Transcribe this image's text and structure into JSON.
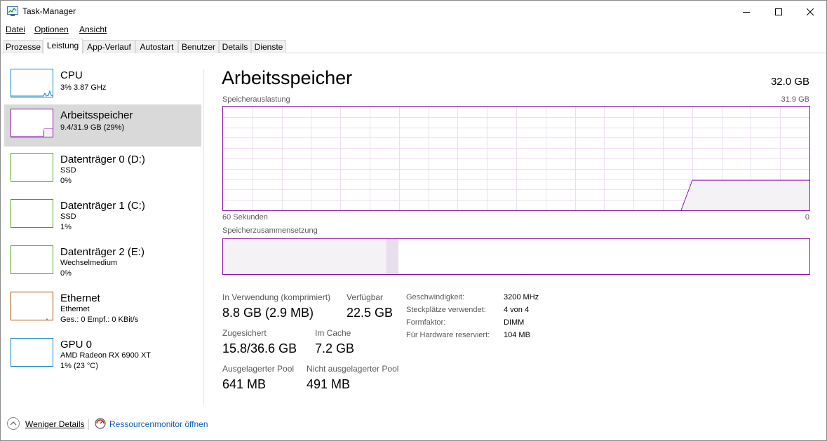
{
  "window": {
    "title": "Task-Manager"
  },
  "menu": [
    {
      "label": "Datei"
    },
    {
      "label": "Optionen"
    },
    {
      "label": "Ansicht"
    }
  ],
  "tabs": [
    {
      "label": "Prozesse"
    },
    {
      "label": "Leistung",
      "active": true
    },
    {
      "label": "App-Verlauf"
    },
    {
      "label": "Autostart"
    },
    {
      "label": "Benutzer"
    },
    {
      "label": "Details"
    },
    {
      "label": "Dienste"
    }
  ],
  "sidebar": {
    "items": [
      {
        "title": "CPU",
        "line1": "3%  3.87 GHz",
        "line2": "",
        "color": "#1182c9"
      },
      {
        "title": "Arbeitsspeicher",
        "line1": "9.4/31.9 GB (29%)",
        "line2": "",
        "color": "#8b12ae",
        "selected": true
      },
      {
        "title": "Datenträger 0 (D:)",
        "line1": "SSD",
        "line2": "0%",
        "color": "#4da60c"
      },
      {
        "title": "Datenträger 1 (C:)",
        "line1": "SSD",
        "line2": "1%",
        "color": "#4da60c"
      },
      {
        "title": "Datenträger 2 (E:)",
        "line1": "Wechselmedium",
        "line2": "0%",
        "color": "#4da60c"
      },
      {
        "title": "Ethernet",
        "line1": "Ethernet",
        "line2": "Ges.: 0 Empf.: 0 KBit/s",
        "color": "#a74f01"
      },
      {
        "title": "GPU 0",
        "line1": "AMD Radeon RX 6900 XT",
        "line2": "1% (23 °C)",
        "color": "#1182c9"
      }
    ]
  },
  "main": {
    "title": "Arbeitsspeicher",
    "total": "32.0 GB",
    "usage_label": "Speicherauslastung",
    "usage_max": "31.9 GB",
    "time_label": "60 Sekunden",
    "time_end": "0",
    "composition_label": "Speicherzusammensetzung",
    "graph_color": "#8b12ae",
    "graph_fill": "#f4f2f4",
    "usage_fraction": 0.29,
    "composition": [
      {
        "part": "in-use",
        "fraction": 0.279
      },
      {
        "part": "modified",
        "fraction": 0.02
      },
      {
        "part": "standby",
        "fraction": 0.207
      },
      {
        "part": "free",
        "fraction": 0.494
      }
    ]
  },
  "stats": {
    "in_use_label": "In Verwendung (komprimiert)",
    "in_use_value": "8.8 GB (2.9 MB)",
    "available_label": "Verfügbar",
    "available_value": "22.5 GB",
    "committed_label": "Zugesichert",
    "committed_value": "15.8/36.6 GB",
    "cached_label": "Im Cache",
    "cached_value": "7.2 GB",
    "paged_label": "Ausgelagerter Pool",
    "paged_value": "641 MB",
    "nonpaged_label": "Nicht ausgelagerter Pool",
    "nonpaged_value": "491 MB"
  },
  "details": [
    {
      "label": "Geschwindigkeit:",
      "value": "3200 MHz"
    },
    {
      "label": "Steckplätze verwendet:",
      "value": "4 von 4"
    },
    {
      "label": "Formfaktor:",
      "value": "DIMM"
    },
    {
      "label": "Für Hardware reserviert:",
      "value": "104 MB"
    }
  ],
  "footer": {
    "fewer_details": "Weniger Details",
    "resource_monitor": "Ressourcenmonitor öffnen"
  }
}
